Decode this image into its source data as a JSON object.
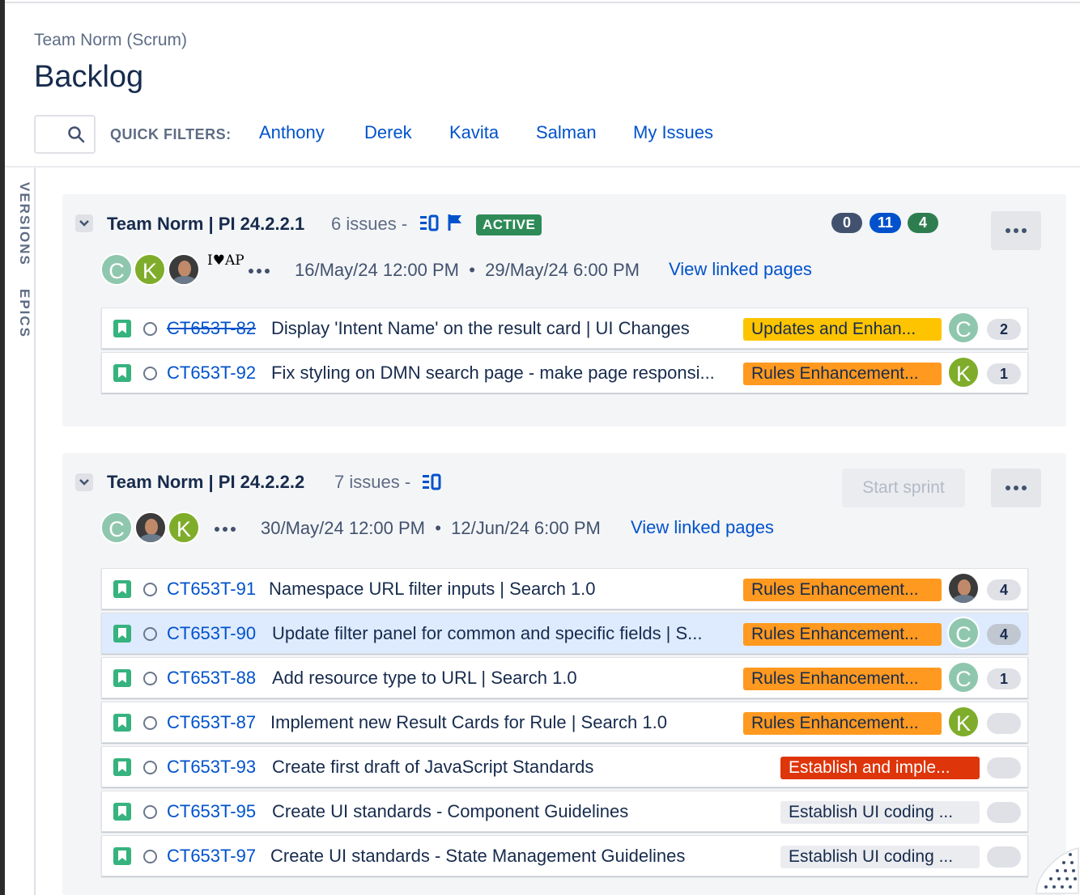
{
  "breadcrumb": "Team Norm (Scrum)",
  "title": "Backlog",
  "quick_filters": {
    "label": "QUICK FILTERS:",
    "items": [
      "Anthony",
      "Derek",
      "Kavita",
      "Salman",
      "My Issues"
    ]
  },
  "side_tabs": [
    "VERSIONS",
    "EPICS"
  ],
  "colors": {
    "link": "#0052cc",
    "story": "#36b37e",
    "todo_pill": "#42526e",
    "in_progress_pill": "#0052cc",
    "done_pill": "#2e7d4f"
  },
  "sprints": [
    {
      "name": "Team Norm | PI 24.2.2.1",
      "issue_count": "6 issues",
      "separator": "-",
      "status": "ACTIVE",
      "stats": [
        "0",
        "11",
        "4"
      ],
      "assignees": [
        "C",
        "K"
      ],
      "assignee_extra": "I♥AP",
      "start": "16/May/24 12:00 PM",
      "end": "29/May/24 6:00 PM",
      "view_linked": "View linked pages",
      "issues": [
        {
          "key": "CT653T-82",
          "summary": "Display 'Intent Name' on the result card | UI Changes",
          "epic": "Updates and Enhan...",
          "assignee": "C",
          "points": "2"
        },
        {
          "key": "CT653T-92",
          "summary": "Fix styling on DMN search page - make page responsi...",
          "epic": "Rules Enhancement...",
          "assignee": "K",
          "points": "1"
        }
      ]
    },
    {
      "name": "Team Norm | PI 24.2.2.2",
      "issue_count": "7 issues",
      "separator": "-",
      "start_button": "Start sprint",
      "assignees": [
        "C",
        "K"
      ],
      "start": "30/May/24 12:00 PM",
      "end": "12/Jun/24 6:00 PM",
      "view_linked": "View linked pages",
      "issues": [
        {
          "key": "CT653T-91",
          "summary": "Namespace URL filter inputs | Search 1.0",
          "epic": "Rules Enhancement...",
          "points": "4"
        },
        {
          "key": "CT653T-90",
          "summary": "Update filter panel for common and specific fields | S...",
          "epic": "Rules Enhancement...",
          "assignee": "C",
          "points": "4"
        },
        {
          "key": "CT653T-88",
          "summary": "Add resource type to URL | Search 1.0",
          "epic": "Rules Enhancement...",
          "assignee": "C",
          "points": "1"
        },
        {
          "key": "CT653T-87",
          "summary": "Implement new Result Cards for Rule | Search 1.0",
          "epic": "Rules Enhancement...",
          "assignee": "K",
          "points": ""
        },
        {
          "key": "CT653T-93",
          "summary": "Create first draft of JavaScript Standards",
          "epic": "Establish and imple...",
          "points": ""
        },
        {
          "key": "CT653T-95",
          "summary": "Create UI standards - Component Guidelines",
          "epic": "Establish UI coding ...",
          "points": ""
        },
        {
          "key": "CT653T-97",
          "summary": "Create UI standards - State Management Guidelines",
          "epic": "Establish UI coding ...",
          "points": ""
        }
      ]
    }
  ]
}
